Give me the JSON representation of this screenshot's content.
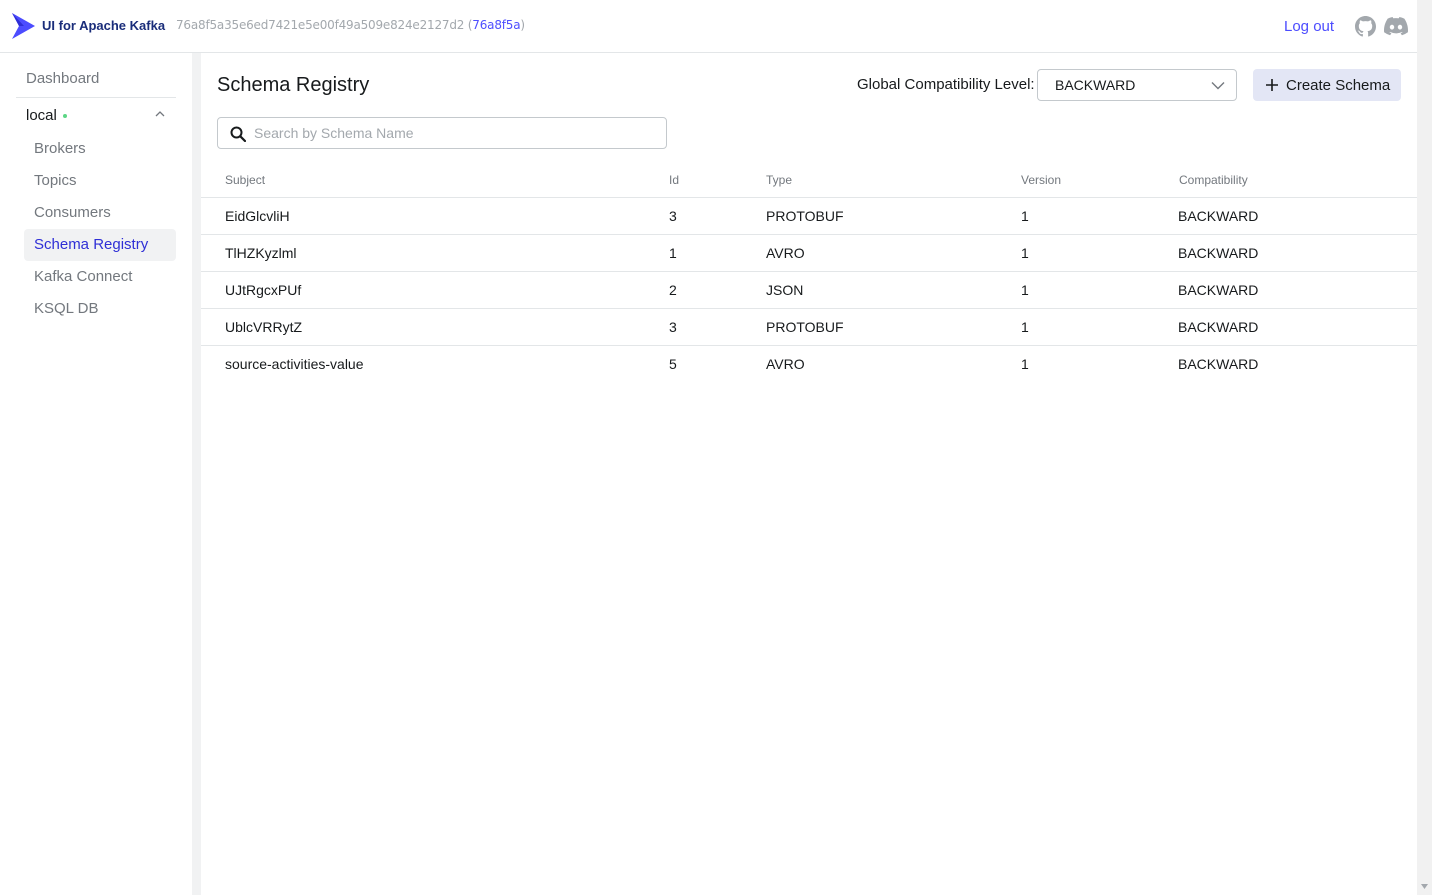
{
  "navbar": {
    "brand": "UI for Apache Kafka",
    "version_hash": "76a8f5a35e6ed7421e5e00f49a509e824e2127d2",
    "version_short": "76a8f5a",
    "logout_label": "Log out",
    "icons": [
      "github-icon",
      "discord-icon"
    ]
  },
  "sidebar": {
    "dashboard": "Dashboard",
    "cluster": "local",
    "cluster_status_color": "#5cd685",
    "items": [
      {
        "label": "Brokers",
        "active": false
      },
      {
        "label": "Topics",
        "active": false
      },
      {
        "label": "Consumers",
        "active": false
      },
      {
        "label": "Schema Registry",
        "active": true
      },
      {
        "label": "Kafka Connect",
        "active": false
      },
      {
        "label": "KSQL DB",
        "active": false
      }
    ]
  },
  "main": {
    "title": "Schema Registry",
    "compat_label": "Global Compatibility Level:",
    "compat_value": "BACKWARD",
    "create_label": "Create Schema",
    "search_placeholder": "Search by Schema Name",
    "columns": [
      "Subject",
      "Id",
      "Type",
      "Version",
      "Compatibility"
    ],
    "rows": [
      {
        "subject": "EidGlcvliH",
        "id": "3",
        "type": "PROTOBUF",
        "version": "1",
        "compatibility": "BACKWARD"
      },
      {
        "subject": "TlHZKyzlml",
        "id": "1",
        "type": "AVRO",
        "version": "1",
        "compatibility": "BACKWARD"
      },
      {
        "subject": "UJtRgcxPUf",
        "id": "2",
        "type": "JSON",
        "version": "1",
        "compatibility": "BACKWARD"
      },
      {
        "subject": "UblcVRRytZ",
        "id": "3",
        "type": "PROTOBUF",
        "version": "1",
        "compatibility": "BACKWARD"
      },
      {
        "subject": "source-activities-value",
        "id": "5",
        "type": "AVRO",
        "version": "1",
        "compatibility": "BACKWARD"
      }
    ]
  },
  "colors": {
    "accent": "#4c4cff",
    "active_nav_text": "#2f2fd6",
    "button_bg": "#e3e6f5"
  }
}
